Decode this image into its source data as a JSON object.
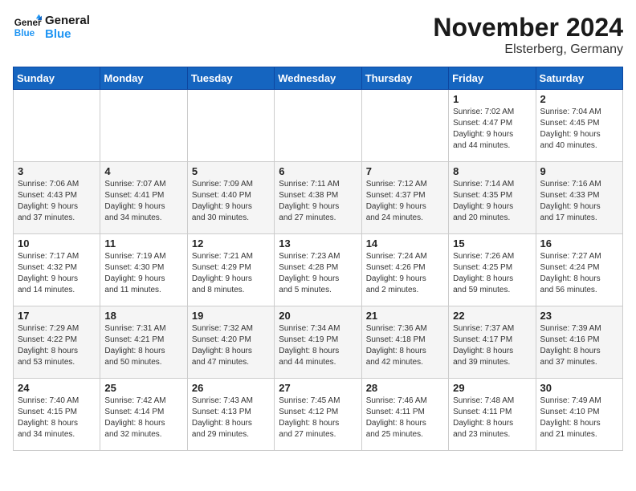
{
  "header": {
    "logo_general": "General",
    "logo_blue": "Blue",
    "month_title": "November 2024",
    "location": "Elsterberg, Germany"
  },
  "days_of_week": [
    "Sunday",
    "Monday",
    "Tuesday",
    "Wednesday",
    "Thursday",
    "Friday",
    "Saturday"
  ],
  "weeks": [
    [
      {
        "day": "",
        "info": ""
      },
      {
        "day": "",
        "info": ""
      },
      {
        "day": "",
        "info": ""
      },
      {
        "day": "",
        "info": ""
      },
      {
        "day": "",
        "info": ""
      },
      {
        "day": "1",
        "info": "Sunrise: 7:02 AM\nSunset: 4:47 PM\nDaylight: 9 hours\nand 44 minutes."
      },
      {
        "day": "2",
        "info": "Sunrise: 7:04 AM\nSunset: 4:45 PM\nDaylight: 9 hours\nand 40 minutes."
      }
    ],
    [
      {
        "day": "3",
        "info": "Sunrise: 7:06 AM\nSunset: 4:43 PM\nDaylight: 9 hours\nand 37 minutes."
      },
      {
        "day": "4",
        "info": "Sunrise: 7:07 AM\nSunset: 4:41 PM\nDaylight: 9 hours\nand 34 minutes."
      },
      {
        "day": "5",
        "info": "Sunrise: 7:09 AM\nSunset: 4:40 PM\nDaylight: 9 hours\nand 30 minutes."
      },
      {
        "day": "6",
        "info": "Sunrise: 7:11 AM\nSunset: 4:38 PM\nDaylight: 9 hours\nand 27 minutes."
      },
      {
        "day": "7",
        "info": "Sunrise: 7:12 AM\nSunset: 4:37 PM\nDaylight: 9 hours\nand 24 minutes."
      },
      {
        "day": "8",
        "info": "Sunrise: 7:14 AM\nSunset: 4:35 PM\nDaylight: 9 hours\nand 20 minutes."
      },
      {
        "day": "9",
        "info": "Sunrise: 7:16 AM\nSunset: 4:33 PM\nDaylight: 9 hours\nand 17 minutes."
      }
    ],
    [
      {
        "day": "10",
        "info": "Sunrise: 7:17 AM\nSunset: 4:32 PM\nDaylight: 9 hours\nand 14 minutes."
      },
      {
        "day": "11",
        "info": "Sunrise: 7:19 AM\nSunset: 4:30 PM\nDaylight: 9 hours\nand 11 minutes."
      },
      {
        "day": "12",
        "info": "Sunrise: 7:21 AM\nSunset: 4:29 PM\nDaylight: 9 hours\nand 8 minutes."
      },
      {
        "day": "13",
        "info": "Sunrise: 7:23 AM\nSunset: 4:28 PM\nDaylight: 9 hours\nand 5 minutes."
      },
      {
        "day": "14",
        "info": "Sunrise: 7:24 AM\nSunset: 4:26 PM\nDaylight: 9 hours\nand 2 minutes."
      },
      {
        "day": "15",
        "info": "Sunrise: 7:26 AM\nSunset: 4:25 PM\nDaylight: 8 hours\nand 59 minutes."
      },
      {
        "day": "16",
        "info": "Sunrise: 7:27 AM\nSunset: 4:24 PM\nDaylight: 8 hours\nand 56 minutes."
      }
    ],
    [
      {
        "day": "17",
        "info": "Sunrise: 7:29 AM\nSunset: 4:22 PM\nDaylight: 8 hours\nand 53 minutes."
      },
      {
        "day": "18",
        "info": "Sunrise: 7:31 AM\nSunset: 4:21 PM\nDaylight: 8 hours\nand 50 minutes."
      },
      {
        "day": "19",
        "info": "Sunrise: 7:32 AM\nSunset: 4:20 PM\nDaylight: 8 hours\nand 47 minutes."
      },
      {
        "day": "20",
        "info": "Sunrise: 7:34 AM\nSunset: 4:19 PM\nDaylight: 8 hours\nand 44 minutes."
      },
      {
        "day": "21",
        "info": "Sunrise: 7:36 AM\nSunset: 4:18 PM\nDaylight: 8 hours\nand 42 minutes."
      },
      {
        "day": "22",
        "info": "Sunrise: 7:37 AM\nSunset: 4:17 PM\nDaylight: 8 hours\nand 39 minutes."
      },
      {
        "day": "23",
        "info": "Sunrise: 7:39 AM\nSunset: 4:16 PM\nDaylight: 8 hours\nand 37 minutes."
      }
    ],
    [
      {
        "day": "24",
        "info": "Sunrise: 7:40 AM\nSunset: 4:15 PM\nDaylight: 8 hours\nand 34 minutes."
      },
      {
        "day": "25",
        "info": "Sunrise: 7:42 AM\nSunset: 4:14 PM\nDaylight: 8 hours\nand 32 minutes."
      },
      {
        "day": "26",
        "info": "Sunrise: 7:43 AM\nSunset: 4:13 PM\nDaylight: 8 hours\nand 29 minutes."
      },
      {
        "day": "27",
        "info": "Sunrise: 7:45 AM\nSunset: 4:12 PM\nDaylight: 8 hours\nand 27 minutes."
      },
      {
        "day": "28",
        "info": "Sunrise: 7:46 AM\nSunset: 4:11 PM\nDaylight: 8 hours\nand 25 minutes."
      },
      {
        "day": "29",
        "info": "Sunrise: 7:48 AM\nSunset: 4:11 PM\nDaylight: 8 hours\nand 23 minutes."
      },
      {
        "day": "30",
        "info": "Sunrise: 7:49 AM\nSunset: 4:10 PM\nDaylight: 8 hours\nand 21 minutes."
      }
    ]
  ]
}
